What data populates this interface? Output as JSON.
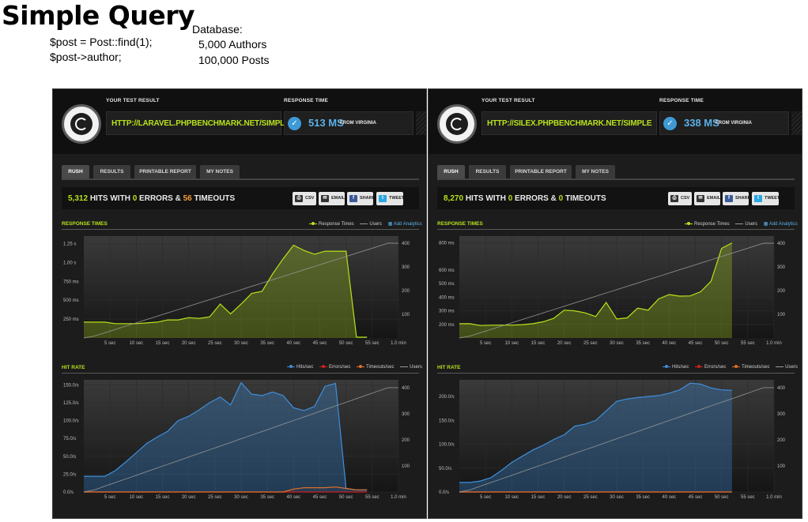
{
  "slide": {
    "title": "Simple Query",
    "code": [
      "$post = Post::find(1);",
      "$post->author;"
    ],
    "db_lines": [
      "Database:",
      "5,000 Authors",
      "100,000 Posts"
    ]
  },
  "ui": {
    "test_result_label": "YOUR TEST RESULT",
    "response_time_label": "RESPONSE TIME",
    "from_label": "FROM VIRGINIA",
    "tabs": [
      "RUSH",
      "RESULTS",
      "PRINTABLE REPORT",
      "MY NOTES"
    ],
    "buttons": [
      "CSV",
      "EMAIL",
      "SHARE",
      "TWEET"
    ],
    "hits_word": "HITS WITH",
    "errors_word": "ERRORS &",
    "timeouts_word": "TIMEOUTS",
    "response_times_title": "RESPONSE TIMES",
    "hit_rate_title": "HIT RATE",
    "legend_rt": "Response Times",
    "legend_users": "Users",
    "legend_add": "Add Analytics",
    "legend_hits": "Hits/sec",
    "legend_errors": "Errors/sec",
    "legend_timeouts": "Timeouts/sec"
  },
  "colors": {
    "green": "#b8e21c",
    "blue": "#3f8fdc",
    "orange": "#e0702a",
    "red": "#d02020",
    "users": "#9a9a9a"
  },
  "panels": [
    {
      "url": "HTTP://LARAVEL.PHPBENCHMARK.NET/SIMPLE",
      "response_ms": "513 MS",
      "hits": "5,312",
      "errors": "0",
      "timeouts": "56"
    },
    {
      "url": "HTTP://SILEX.PHPBENCHMARK.NET/SIMPLE",
      "response_ms": "338 MS",
      "hits": "8,270",
      "errors": "0",
      "timeouts": "0"
    }
  ],
  "chart_data": [
    {
      "type": "area",
      "title": "RESPONSE TIMES",
      "panel": "laravel",
      "x_ticks": [
        "5 sec",
        "10 sec",
        "15 sec",
        "20 sec",
        "25 sec",
        "30 sec",
        "35 sec",
        "40 sec",
        "45 sec",
        "50 sec",
        "55 sec",
        "1.0 min"
      ],
      "y_ticks": [
        "250 ms",
        "500 ms",
        "750 ms",
        "1.00 s",
        "1.25 s"
      ],
      "y2_ticks": [
        "100",
        "200",
        "300",
        "400"
      ],
      "ylim": [
        0,
        1.35
      ],
      "y2lim": [
        0,
        430
      ],
      "x": [
        0,
        2,
        4,
        6,
        8,
        10,
        12,
        14,
        16,
        18,
        20,
        22,
        24,
        26,
        28,
        30,
        32,
        34,
        36,
        38,
        40,
        42,
        44,
        46,
        48,
        50,
        52,
        54,
        56,
        58,
        60
      ],
      "series": [
        {
          "name": "Response Times",
          "values": [
            0.21,
            0.21,
            0.21,
            0.19,
            0.19,
            0.19,
            0.2,
            0.21,
            0.24,
            0.24,
            0.27,
            0.26,
            0.28,
            0.45,
            0.32,
            0.45,
            0.59,
            0.62,
            0.85,
            1.05,
            1.23,
            1.16,
            1.11,
            1.15,
            1.15,
            1.15,
            0.01,
            0.01,
            null,
            null,
            null
          ]
        },
        {
          "name": "Users",
          "values": [
            0,
            8,
            22,
            36,
            50,
            64,
            78,
            92,
            106,
            120,
            134,
            148,
            162,
            176,
            190,
            204,
            218,
            232,
            246,
            260,
            274,
            288,
            302,
            316,
            330,
            344,
            358,
            372,
            386,
            400,
            400
          ]
        }
      ]
    },
    {
      "type": "area",
      "title": "HIT RATE",
      "panel": "laravel",
      "x_ticks": [
        "5 sec",
        "10 sec",
        "15 sec",
        "20 sec",
        "25 sec",
        "30 sec",
        "35 sec",
        "40 sec",
        "45 sec",
        "50 sec",
        "55 sec",
        "1.0 min"
      ],
      "y_ticks": [
        "0.0/s",
        "25.0/s",
        "50.0/s",
        "75.0/s",
        "100.0/s",
        "125.0/s",
        "150.0/s"
      ],
      "y2_ticks": [
        "100",
        "200",
        "300",
        "400"
      ],
      "ylim": [
        0,
        157
      ],
      "y2lim": [
        0,
        430
      ],
      "x": [
        0,
        2,
        4,
        6,
        8,
        10,
        12,
        14,
        16,
        18,
        20,
        22,
        24,
        26,
        28,
        30,
        32,
        34,
        36,
        38,
        40,
        42,
        44,
        46,
        48,
        50,
        52,
        54,
        56,
        58,
        60
      ],
      "series": [
        {
          "name": "Hits/sec",
          "values": [
            22,
            22,
            22,
            30,
            42,
            55,
            68,
            77,
            85,
            100,
            106,
            115,
            125,
            133,
            122,
            153,
            137,
            135,
            140,
            135,
            118,
            114,
            120,
            148,
            152,
            5,
            3,
            3,
            null,
            null,
            null
          ]
        },
        {
          "name": "Errors/sec",
          "values": [
            0,
            0,
            0,
            0,
            0,
            0,
            0,
            0,
            0,
            0,
            0,
            0,
            0,
            0,
            0,
            0,
            0,
            0,
            0,
            0,
            0,
            0,
            0,
            0,
            0,
            0,
            0,
            0,
            null,
            null,
            null
          ]
        },
        {
          "name": "Timeouts/sec",
          "values": [
            0,
            0,
            0,
            0,
            0,
            0,
            0,
            0,
            0,
            0,
            0,
            0,
            0,
            0,
            0,
            0,
            0,
            0,
            0,
            0,
            4,
            6,
            6,
            6,
            7,
            5,
            3,
            3,
            null,
            null,
            null
          ]
        },
        {
          "name": "Users",
          "values": [
            0,
            8,
            22,
            36,
            50,
            64,
            78,
            92,
            106,
            120,
            134,
            148,
            162,
            176,
            190,
            204,
            218,
            232,
            246,
            260,
            274,
            288,
            302,
            316,
            330,
            344,
            358,
            372,
            386,
            400,
            400
          ]
        }
      ]
    },
    {
      "type": "area",
      "title": "RESPONSE TIMES",
      "panel": "silex",
      "x_ticks": [
        "5 sec",
        "10 sec",
        "15 sec",
        "20 sec",
        "25 sec",
        "30 sec",
        "35 sec",
        "40 sec",
        "45 sec",
        "50 sec",
        "55 sec",
        "1.0 min"
      ],
      "y_ticks": [
        "200 ms",
        "300 ms",
        "400 ms",
        "500 ms",
        "600 ms",
        "800 ms"
      ],
      "y2_ticks": [
        "100",
        "200",
        "300",
        "400"
      ],
      "ylim": [
        100,
        850
      ],
      "y2lim": [
        0,
        430
      ],
      "x": [
        0,
        2,
        4,
        6,
        8,
        10,
        12,
        14,
        16,
        18,
        20,
        22,
        24,
        26,
        28,
        30,
        32,
        34,
        36,
        38,
        40,
        42,
        44,
        46,
        48,
        50,
        52,
        54,
        56,
        58,
        60
      ],
      "series": [
        {
          "name": "Response Times",
          "values": [
            205,
            205,
            192,
            194,
            195,
            195,
            198,
            205,
            220,
            245,
            305,
            300,
            285,
            258,
            362,
            240,
            248,
            320,
            305,
            388,
            420,
            408,
            410,
            440,
            518,
            760,
            800,
            null,
            null,
            null,
            null
          ]
        },
        {
          "name": "Users",
          "values": [
            0,
            8,
            22,
            36,
            50,
            64,
            78,
            92,
            106,
            120,
            134,
            148,
            162,
            176,
            190,
            204,
            218,
            232,
            246,
            260,
            274,
            288,
            302,
            316,
            330,
            344,
            358,
            372,
            386,
            400,
            400
          ]
        }
      ]
    },
    {
      "type": "area",
      "title": "HIT RATE",
      "panel": "silex",
      "x_ticks": [
        "5 sec",
        "10 sec",
        "15 sec",
        "20 sec",
        "25 sec",
        "30 sec",
        "35 sec",
        "40 sec",
        "45 sec",
        "50 sec",
        "55 sec",
        "1.0 min"
      ],
      "y_ticks": [
        "0.0/s",
        "50.0/s",
        "100.0/s",
        "150.0/s",
        "200.0/s"
      ],
      "y2_ticks": [
        "100",
        "200",
        "300",
        "400"
      ],
      "ylim": [
        0,
        235
      ],
      "y2lim": [
        0,
        430
      ],
      "x": [
        0,
        2,
        4,
        6,
        8,
        10,
        12,
        14,
        16,
        18,
        20,
        22,
        24,
        26,
        28,
        30,
        32,
        34,
        36,
        38,
        40,
        42,
        44,
        46,
        48,
        50,
        52,
        54,
        56,
        58,
        60
      ],
      "series": [
        {
          "name": "Hits/sec",
          "values": [
            20,
            20,
            23,
            30,
            45,
            62,
            75,
            88,
            98,
            110,
            120,
            138,
            142,
            150,
            170,
            190,
            195,
            198,
            200,
            202,
            207,
            214,
            228,
            226,
            218,
            214,
            213,
            null,
            null,
            null,
            null
          ]
        },
        {
          "name": "Errors/sec",
          "values": [
            0,
            0,
            0,
            0,
            0,
            0,
            0,
            0,
            0,
            0,
            0,
            0,
            0,
            0,
            0,
            0,
            0,
            0,
            0,
            0,
            0,
            0,
            0,
            0,
            0,
            0,
            0,
            null,
            null,
            null,
            null
          ]
        },
        {
          "name": "Timeouts/sec",
          "values": [
            0,
            0,
            0,
            0,
            0,
            0,
            0,
            0,
            0,
            0,
            0,
            0,
            0,
            0,
            0,
            0,
            0,
            0,
            0,
            0,
            0,
            0,
            0,
            0,
            0,
            0,
            0,
            null,
            null,
            null,
            null
          ]
        },
        {
          "name": "Users",
          "values": [
            0,
            8,
            22,
            36,
            50,
            64,
            78,
            92,
            106,
            120,
            134,
            148,
            162,
            176,
            190,
            204,
            218,
            232,
            246,
            260,
            274,
            288,
            302,
            316,
            330,
            344,
            358,
            372,
            386,
            400,
            400
          ]
        }
      ]
    }
  ]
}
